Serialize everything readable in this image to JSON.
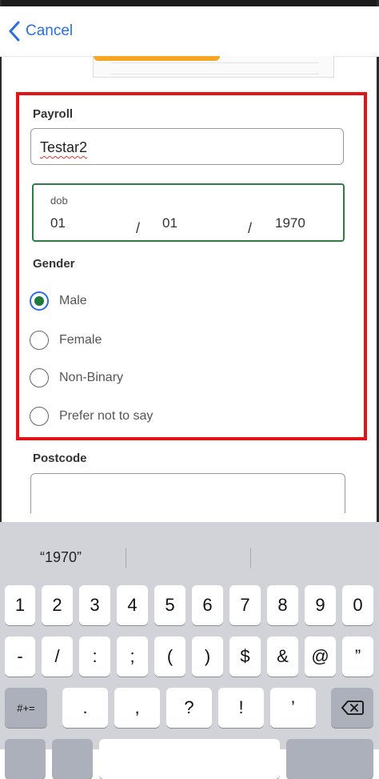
{
  "nav": {
    "cancel_label": "Cancel"
  },
  "form": {
    "payroll_label": "Payroll",
    "payroll_value": "Testar2",
    "dob": {
      "label": "dob",
      "day": "01",
      "month": "01",
      "year": "1970",
      "separator": "/"
    },
    "gender_label": "Gender",
    "gender_options": [
      "Male",
      "Female",
      "Non-Binary",
      "Prefer not to say"
    ],
    "gender_selected": "Male",
    "postcode_label": "Postcode",
    "postcode_value": ""
  },
  "keyboard": {
    "suggestion": "“1970”",
    "row1": [
      "1",
      "2",
      "3",
      "4",
      "5",
      "6",
      "7",
      "8",
      "9",
      "0"
    ],
    "row2": [
      "-",
      "/",
      ":",
      ";",
      "(",
      ")",
      "$",
      "&",
      "@",
      "”"
    ],
    "row3_left": "#+=",
    "row3": [
      ".",
      ",",
      "?",
      "!",
      "’"
    ],
    "backspace_icon": "backspace-icon"
  },
  "colors": {
    "accent_blue": "#2a6fe0",
    "highlight_red": "#e01414",
    "focus_green": "#2f7d45",
    "radio_fill": "#1e7a3c",
    "keyboard_bg": "#d1d3d9"
  }
}
